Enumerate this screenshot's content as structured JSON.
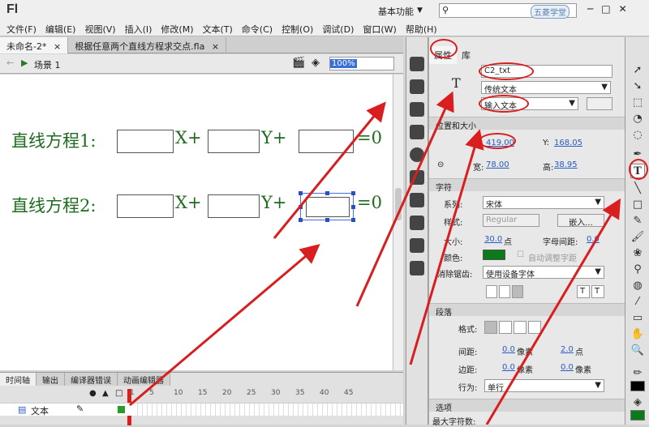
{
  "app": {
    "logo": "Fl",
    "workspace": "基本功能",
    "watermark": "五菱学堂"
  },
  "menu": [
    "文件(F)",
    "编辑(E)",
    "视图(V)",
    "插入(I)",
    "修改(M)",
    "文本(T)",
    "命令(C)",
    "控制(O)",
    "调试(D)",
    "窗口(W)",
    "帮助(H)"
  ],
  "doc_tabs": [
    "未命名-2*",
    "根据任意两个直线方程求交点.fla"
  ],
  "scene": "场景 1",
  "zoom": "100%",
  "canvas": {
    "line1": {
      "label": "直线方程1:",
      "x": "X+",
      "y": "Y+",
      "eq": "=0"
    },
    "line2": {
      "label": "直线方程2:",
      "x": "X+",
      "y": "Y+",
      "eq": "=0"
    }
  },
  "timeline": {
    "tabs": [
      "时间轴",
      "输出",
      "编译器错误",
      "动画编辑器"
    ],
    "frames": [
      "1",
      "5",
      "10",
      "15",
      "20",
      "25",
      "30",
      "35",
      "40",
      "45"
    ],
    "layer": "文本"
  },
  "props": {
    "tabs": [
      "属性",
      "库"
    ],
    "instance_name": "C2_txt",
    "text_engine": "传统文本",
    "text_type": "输入文本",
    "sec_position": "位置和大小",
    "x_label": "X:",
    "x": "419.00",
    "y_label": "Y:",
    "y": "168.05",
    "w_label": "宽:",
    "w": "78.00",
    "h_label": "高:",
    "h": "38.95",
    "sec_char": "字符",
    "family_label": "系列:",
    "family": "宋体",
    "style_label": "样式:",
    "style": "Regular",
    "embed": "嵌入...",
    "size_label": "大小:",
    "size": "30.0",
    "size_unit": "点",
    "spacing_label": "字母间距:",
    "spacing": "0.0",
    "color_label": "颜色:",
    "auto_kern": "自动调整字距",
    "aa_label": "消除锯齿:",
    "aa": "使用设备字体",
    "sec_para": "段落",
    "format_label": "格式:",
    "gap_label": "间距:",
    "indent": "0.0",
    "indent_unit": "像素",
    "leading": "2.0",
    "leading_unit": "点",
    "margin_label": "边距:",
    "margin_l": "0.0",
    "margin_l_unit": "像素",
    "margin_r": "0.0",
    "margin_r_unit": "像素",
    "behavior_label": "行为:",
    "behavior": "单行",
    "sec_options": "选项",
    "maxchars_label": "最大字符数:"
  },
  "accent": "#d81e1e"
}
